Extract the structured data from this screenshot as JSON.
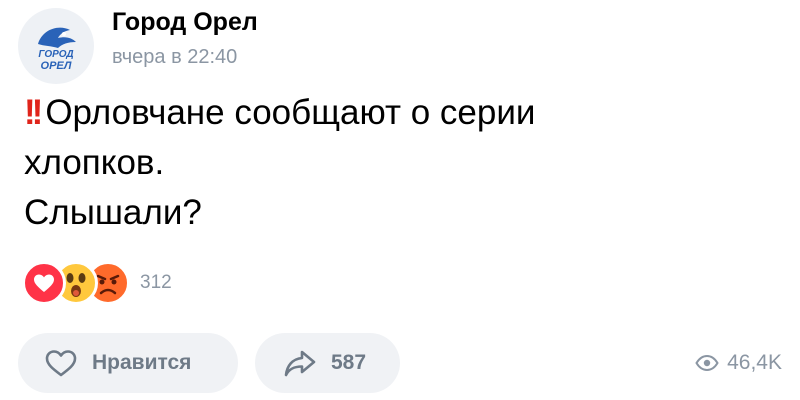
{
  "post": {
    "author": "Город Орел",
    "timestamp": "вчера в 22:40",
    "avatar": {
      "icon": "eagle-logo-icon",
      "logo_text_top": "ГОРОД",
      "logo_text_bottom": "ОРЕЛ",
      "color": "#2a63b8"
    },
    "text": {
      "emoji": "double-exclamation-icon",
      "lines": [
        "Орловчане сообщают о серии",
        "хлопков.",
        "Слышали?"
      ]
    },
    "reactions": {
      "icons": [
        "heart-reaction-icon",
        "surprised-reaction-icon",
        "angry-reaction-icon"
      ],
      "count": "312"
    },
    "actions": {
      "like_label": "Нравится",
      "share_count": "587",
      "views_count": "46,4K"
    },
    "colors": {
      "accent_red": "#e0241b",
      "muted_text": "#8b96a3",
      "pill_bg": "#f0f2f5"
    }
  }
}
